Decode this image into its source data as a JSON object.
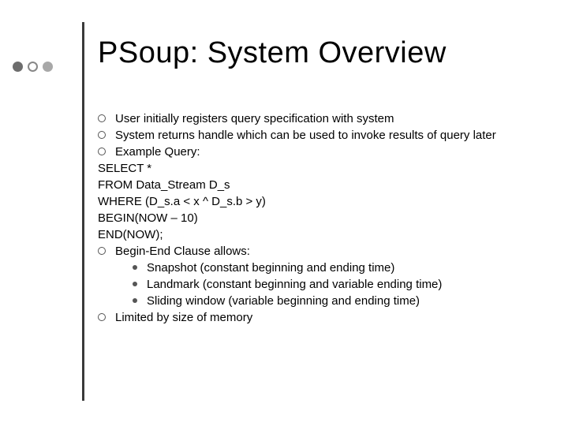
{
  "title": "PSoup: System Overview",
  "body": [
    {
      "kind": "b1",
      "text": "User initially registers query specification with system"
    },
    {
      "kind": "b1",
      "text": "System returns handle which can be used to invoke results of query later"
    },
    {
      "kind": "b1",
      "text": "Example Query:"
    },
    {
      "kind": "plain",
      "text": "SELECT *"
    },
    {
      "kind": "plain",
      "text": "FROM Data_Stream D_s"
    },
    {
      "kind": "plain",
      "text": "WHERE (D_s.a < x ^ D_s.b > y)"
    },
    {
      "kind": "plain",
      "text": "BEGIN(NOW – 10)"
    },
    {
      "kind": "plain",
      "text": "END(NOW);"
    },
    {
      "kind": "b1",
      "text": "Begin-End Clause allows:"
    },
    {
      "kind": "b2",
      "text": "Snapshot (constant beginning and ending time)"
    },
    {
      "kind": "b2",
      "text": "Landmark (constant beginning and variable ending time)"
    },
    {
      "kind": "b2",
      "text": "Sliding window (variable beginning and ending time)"
    },
    {
      "kind": "b1",
      "text": "Limited by size of memory"
    }
  ]
}
